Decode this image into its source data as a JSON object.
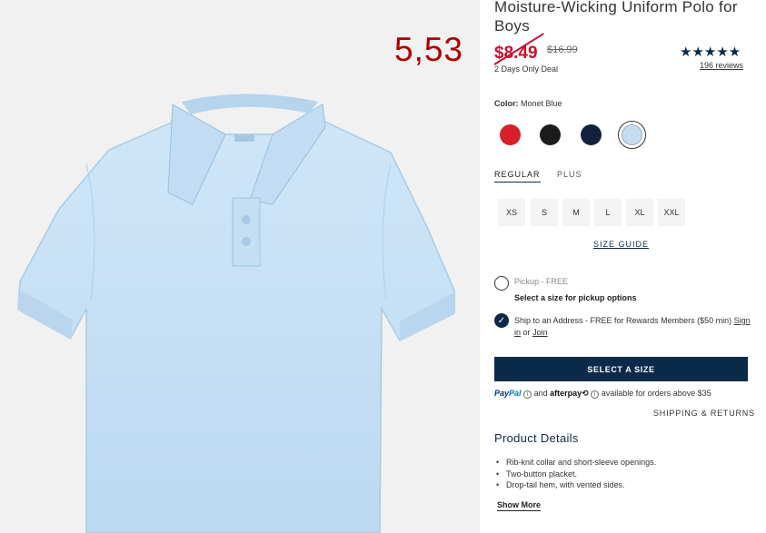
{
  "product": {
    "title": "Moisture-Wicking Uniform Polo for Boys",
    "overlay_price": "5,53",
    "sale_price": "$8.49",
    "original_price": "$16.99",
    "deal_text": "2 Days Only Deal",
    "rating_stars": "★★★★★",
    "reviews": "196 reviews"
  },
  "colors": {
    "label": "Color:",
    "selected": "Monet Blue",
    "swatches": [
      {
        "name": "red",
        "hex": "#d81f2a"
      },
      {
        "name": "black",
        "hex": "#1c1c1c"
      },
      {
        "name": "navy",
        "hex": "#14213d"
      },
      {
        "name": "monet-blue",
        "hex": "#c5dcf0"
      }
    ]
  },
  "fit": {
    "tabs": [
      "REGULAR",
      "PLUS"
    ],
    "active": "REGULAR"
  },
  "sizes": [
    "XS",
    "S",
    "M",
    "L",
    "XL",
    "XXL"
  ],
  "size_guide": "SIZE GUIDE",
  "fulfillment": {
    "pickup_label": "Pickup - FREE",
    "pickup_note": "Select a size for pickup options",
    "ship_text": "Ship to an Address - FREE for Rewards Members ($50 min)",
    "sign_in": "Sign in",
    "or": "or",
    "join": "Join"
  },
  "cta": "SELECT A SIZE",
  "payment": {
    "paypal_a": "Pay",
    "paypal_b": "Pal",
    "and": "and",
    "afterpay": "afterpay",
    "afterpay_glyph": "⟲",
    "info_glyph": "i",
    "note": "available for orders above $35"
  },
  "shipping_returns": "SHIPPING & RETURNS",
  "details": {
    "title": "Product Details",
    "items": [
      "Rib-knit collar and short-sleeve openings.",
      "Two-button placket.",
      "Drop-tail hem, with vented sides."
    ],
    "show_more": "Show More"
  },
  "theme": {
    "navy": "#0b2a4a",
    "sale_red": "#c8102e",
    "shirt": "#c6e1f5"
  }
}
